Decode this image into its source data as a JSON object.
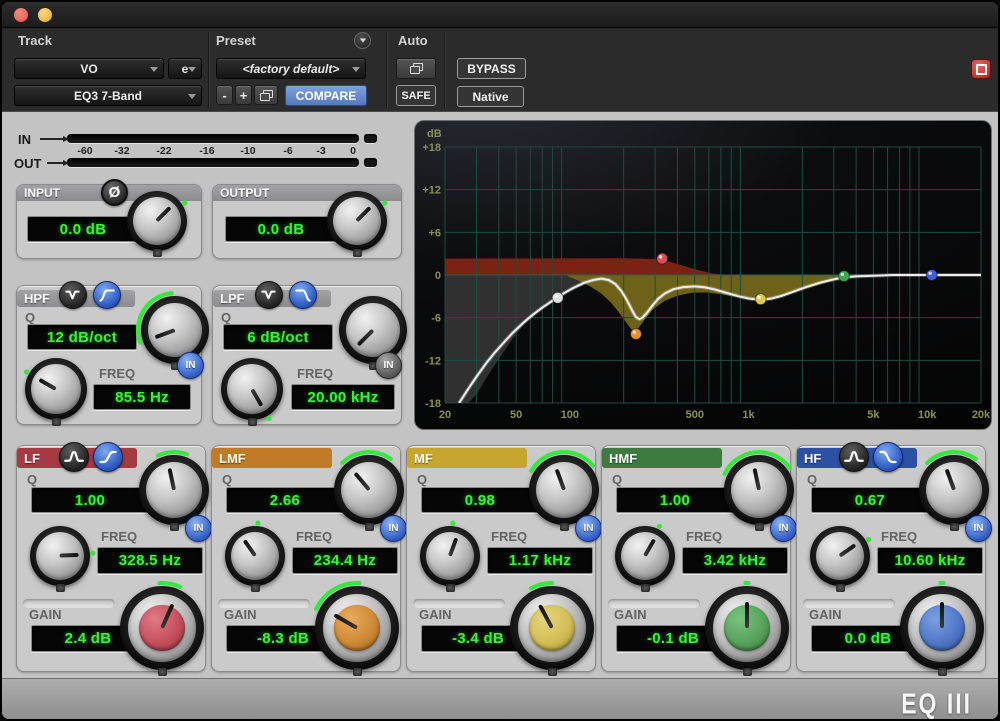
{
  "header": {
    "track": {
      "label": "Track",
      "name": "VO",
      "edit": "e",
      "plugin": "EQ3 7-Band"
    },
    "preset": {
      "label": "Preset",
      "value": "<factory default>",
      "minus": "-",
      "plus": "+",
      "compare": "COMPARE"
    },
    "auto": {
      "label": "Auto",
      "safe": "SAFE"
    },
    "bypass": "BYPASS",
    "native": "Native"
  },
  "meters": {
    "in": "IN",
    "out": "OUT",
    "scale": [
      "-60",
      "-32",
      "-22",
      "-16",
      "-10",
      "-6",
      "-3",
      "0"
    ]
  },
  "io": {
    "input": {
      "label": "INPUT",
      "phase": "Ø",
      "value": "0.0 dB",
      "knob": {
        "deg": 45,
        "dot": 57
      }
    },
    "output": {
      "label": "OUTPUT",
      "value": "0.0 dB",
      "knob": {
        "deg": 45,
        "dot": 57
      }
    }
  },
  "filters": {
    "hpf": {
      "label": "HPF",
      "q_label": "Q",
      "slope": "12 dB/oct",
      "freq_label": "FREQ",
      "freq": "85.5 Hz",
      "in": "IN",
      "in_active": true,
      "icons": [
        "notch-filter-icon",
        "highpass-curve-icon"
      ],
      "q_knob": {
        "deg": -110,
        "arc": [
          -110,
          -5
        ]
      },
      "freq_knob": {
        "deg": -60,
        "dot": -60
      }
    },
    "lpf": {
      "label": "LPF",
      "q_label": "Q",
      "slope": "6 dB/oct",
      "freq_label": "FREQ",
      "freq": "20.00 kHz",
      "in": "IN",
      "in_active": false,
      "icons": [
        "notch-filter-icon",
        "lowpass-curve-icon"
      ],
      "q_knob": {
        "deg": -135
      },
      "freq_knob": {
        "deg": 150,
        "dot": 150
      }
    }
  },
  "bands": [
    {
      "id": "lf",
      "label": "LF",
      "q_label": "Q",
      "q": "1.00",
      "freq_label": "FREQ",
      "freq": "328.5 Hz",
      "gain_label": "GAIN",
      "gain": "2.4 dB",
      "in": "IN",
      "strip": "#a63a42",
      "cap": [
        "#e07a82",
        "#c4505c",
        "#8e2e38"
      ],
      "icons": [
        "bell-curve-icon",
        "low-shelf-icon"
      ],
      "q_knob": {
        "deg": -12,
        "arc": [
          -25,
          20
        ]
      },
      "freq_knob": {
        "deg": 88,
        "dot": 85
      },
      "gain_knob": {
        "deg": 24,
        "arc": [
          -3,
          24
        ]
      }
    },
    {
      "id": "lmf",
      "label": "LMF",
      "q_label": "Q",
      "q": "2.66",
      "freq_label": "FREQ",
      "freq": "234.4 Hz",
      "gain_label": "GAIN",
      "gain": "-8.3 dB",
      "in": "IN",
      "strip": "#c17a26",
      "cap": [
        "#e8ab5e",
        "#cf8a35",
        "#9a5f1e"
      ],
      "q_knob": {
        "deg": -40,
        "arc": [
          -45,
          35
        ]
      },
      "freq_knob": {
        "deg": -35,
        "dot": 5
      },
      "gain_knob": {
        "deg": -60,
        "arc": [
          -65,
          3
        ]
      }
    },
    {
      "id": "mf",
      "label": "MF",
      "q_label": "Q",
      "q": "0.98",
      "freq_label": "FREQ",
      "freq": "1.17 kHz",
      "gain_label": "GAIN",
      "gain": "-3.4 dB",
      "in": "IN",
      "strip": "#c6a62e",
      "cap": [
        "#e6d47e",
        "#d2bd55",
        "#9e8a30"
      ],
      "q_knob": {
        "deg": -20,
        "arc": [
          -60,
          50
        ]
      },
      "freq_knob": {
        "deg": 20,
        "dot": 5
      },
      "gain_knob": {
        "deg": -28,
        "arc": [
          -28,
          0
        ]
      }
    },
    {
      "id": "hmf",
      "label": "HMF",
      "q_label": "Q",
      "q": "1.00",
      "freq_label": "FREQ",
      "freq": "3.42 kHz",
      "gain_label": "GAIN",
      "gain": "-0.1 dB",
      "in": "IN",
      "strip": "#3e7b40",
      "cap": [
        "#7cc281",
        "#57a25c",
        "#357a3c"
      ],
      "q_knob": {
        "deg": -12,
        "arc": [
          -65,
          55
        ]
      },
      "freq_knob": {
        "deg": 30,
        "dot": 26
      },
      "gain_knob": {
        "deg": 0,
        "arc": [
          -2,
          2
        ]
      }
    },
    {
      "id": "hf",
      "label": "HF",
      "q_label": "Q",
      "q": "0.67",
      "freq_label": "FREQ",
      "freq": "10.60 kHz",
      "gain_label": "GAIN",
      "gain": "0.0 dB",
      "in": "IN",
      "strip": "#2d50a5",
      "cap": [
        "#7a9ee0",
        "#5078c8",
        "#2e4e96"
      ],
      "icons": [
        "bell-curve-icon",
        "high-shelf-icon"
      ],
      "q_knob": {
        "deg": -20,
        "arc": [
          -45,
          35
        ]
      },
      "freq_knob": {
        "deg": 55,
        "dot": 60
      },
      "gain_knob": {
        "deg": 0,
        "arc": [
          -2,
          2
        ]
      }
    }
  ],
  "chart_data": {
    "type": "line",
    "unit_label": "dB",
    "x_scale": "log",
    "f_range": [
      20,
      20000
    ],
    "db_range": [
      -18,
      18
    ],
    "grid_color": "#1d4c44",
    "zero_line_color": "#2a6157",
    "label_color": "#8a9155",
    "curve_color": "#ececec",
    "y_ticks": [
      {
        "v": 18,
        "label": "+18"
      },
      {
        "v": 12,
        "label": "+12"
      },
      {
        "v": 6,
        "label": "+6"
      },
      {
        "v": 0,
        "label": "0"
      },
      {
        "v": -6,
        "label": "-6"
      },
      {
        "v": -12,
        "label": "-12"
      },
      {
        "v": -18,
        "label": "-18"
      }
    ],
    "x_ticks": [
      {
        "f": 20,
        "label": "20"
      },
      {
        "f": 50,
        "label": "50"
      },
      {
        "f": 100,
        "label": "100"
      },
      {
        "f": 500,
        "label": "500"
      },
      {
        "f": 1000,
        "label": "1k"
      },
      {
        "f": 5000,
        "label": "5k"
      },
      {
        "f": 10000,
        "label": "10k"
      },
      {
        "f": 20000,
        "label": "20k"
      }
    ],
    "curve": [
      [
        24,
        -18
      ],
      [
        27,
        -16
      ],
      [
        30,
        -14.3
      ],
      [
        34,
        -12.4
      ],
      [
        38,
        -10.9
      ],
      [
        43,
        -9.4
      ],
      [
        48,
        -8.1
      ],
      [
        55,
        -6.7
      ],
      [
        62,
        -5.6
      ],
      [
        70,
        -4.6
      ],
      [
        78,
        -3.8
      ],
      [
        85.5,
        -3.1
      ],
      [
        95,
        -2.4
      ],
      [
        105,
        -1.8
      ],
      [
        120,
        -1.1
      ],
      [
        135,
        -0.7
      ],
      [
        150,
        -0.5
      ],
      [
        165,
        -0.7
      ],
      [
        180,
        -1.3
      ],
      [
        195,
        -2.3
      ],
      [
        210,
        -3.7
      ],
      [
        222,
        -4.9
      ],
      [
        234,
        -5.9
      ],
      [
        245,
        -6.2
      ],
      [
        255,
        -6.0
      ],
      [
        270,
        -5.3
      ],
      [
        290,
        -4.3
      ],
      [
        310,
        -3.4
      ],
      [
        340,
        -2.6
      ],
      [
        380,
        -2.0
      ],
      [
        430,
        -1.7
      ],
      [
        500,
        -1.6
      ],
      [
        560,
        -1.7
      ],
      [
        640,
        -2.0
      ],
      [
        750,
        -2.5
      ],
      [
        880,
        -3.0
      ],
      [
        1000,
        -3.3
      ],
      [
        1170,
        -3.5
      ],
      [
        1350,
        -3.3
      ],
      [
        1550,
        -2.9
      ],
      [
        1800,
        -2.3
      ],
      [
        2100,
        -1.7
      ],
      [
        2500,
        -1.1
      ],
      [
        3000,
        -0.6
      ],
      [
        3420,
        -0.35
      ],
      [
        4000,
        -0.2
      ],
      [
        5000,
        -0.1
      ],
      [
        6500,
        0
      ],
      [
        10000,
        0
      ],
      [
        14000,
        0
      ],
      [
        20000,
        0
      ]
    ],
    "dots": [
      {
        "f": 85.5,
        "db": -3.2,
        "color": "#e0e0e0",
        "name": "hpf-handle"
      },
      {
        "f": 234.4,
        "db": -8.3,
        "color": "#e8902e",
        "name": "lmf-handle"
      },
      {
        "f": 328.5,
        "db": 2.3,
        "color": "#d8505a",
        "name": "lf-handle"
      },
      {
        "f": 1170,
        "db": -3.4,
        "color": "#e2c84e",
        "name": "mf-handle"
      },
      {
        "f": 3420,
        "db": -0.15,
        "color": "#3aa84c",
        "name": "hmf-handle"
      },
      {
        "f": 10600,
        "db": 0,
        "color": "#4060e0",
        "name": "hf-handle"
      }
    ],
    "areas": [
      {
        "name": "hpf-cut-region",
        "color": "#303030",
        "points": [
          [
            20,
            0
          ],
          [
            300,
            0
          ],
          [
            260,
            -0.1
          ],
          [
            200,
            -0.35
          ],
          [
            150,
            -0.8
          ],
          [
            120,
            -1.4
          ],
          [
            100,
            -2.1
          ],
          [
            85.5,
            -3
          ],
          [
            70,
            -4.6
          ],
          [
            60,
            -6
          ],
          [
            50,
            -8.3
          ],
          [
            42,
            -11
          ],
          [
            35,
            -14
          ],
          [
            30,
            -16.8
          ],
          [
            27,
            -18
          ],
          [
            20,
            -18
          ]
        ]
      },
      {
        "name": "lf-boost-region",
        "color": "#7c2212",
        "points": [
          [
            20,
            2.3
          ],
          [
            200,
            2.35
          ],
          [
            300,
            2.25
          ],
          [
            360,
            1.9
          ],
          [
            430,
            1.3
          ],
          [
            520,
            0.7
          ],
          [
            620,
            0.25
          ],
          [
            720,
            0.05
          ],
          [
            780,
            0
          ],
          [
            20,
            0
          ]
        ]
      },
      {
        "name": "mid-cut-region",
        "color": "#6e6218",
        "points": [
          [
            95,
            0
          ],
          [
            4200,
            0
          ],
          [
            3400,
            -0.45
          ],
          [
            2700,
            -1.1
          ],
          [
            2100,
            -1.9
          ],
          [
            1600,
            -2.8
          ],
          [
            1300,
            -3.3
          ],
          [
            1170,
            -3.45
          ],
          [
            1000,
            -3.35
          ],
          [
            850,
            -3.05
          ],
          [
            700,
            -2.7
          ],
          [
            580,
            -2.45
          ],
          [
            480,
            -2.5
          ],
          [
            400,
            -2.9
          ],
          [
            340,
            -3.6
          ],
          [
            290,
            -4.9
          ],
          [
            258,
            -6.5
          ],
          [
            240,
            -7.6
          ],
          [
            234,
            -8.3
          ],
          [
            225,
            -7.9
          ],
          [
            210,
            -6.9
          ],
          [
            190,
            -5.4
          ],
          [
            170,
            -3.9
          ],
          [
            150,
            -2.6
          ],
          [
            130,
            -1.6
          ],
          [
            112,
            -0.8
          ],
          [
            100,
            -0.3
          ]
        ]
      }
    ]
  },
  "footer": {
    "logo": "EQ III"
  }
}
